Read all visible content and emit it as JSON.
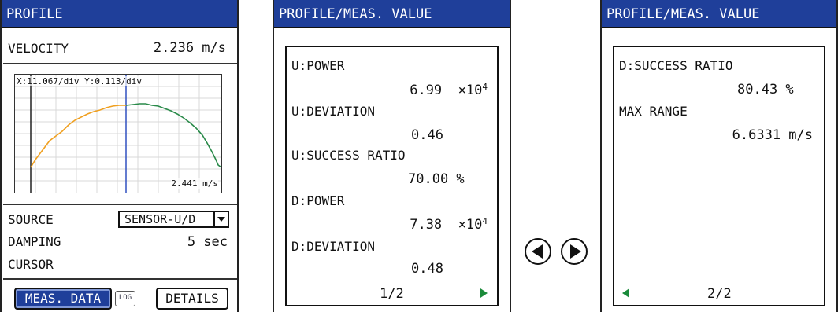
{
  "profile_panel": {
    "title": "PROFILE",
    "velocity_label": "VELOCITY",
    "velocity_value": "2.236 m/s",
    "graph_scale": "X:11.067/div Y:0.113/div",
    "graph_value": "2.441 m/s",
    "source_label": "SOURCE",
    "source_value": "SENSOR-U/D",
    "damping_label": "DAMPING",
    "damping_value": "5 sec",
    "cursor_label": "CURSOR",
    "meas_button": "MEAS. DATA",
    "log_badge": "LOG",
    "details_button": "DETAILS"
  },
  "page1": {
    "title": "PROFILE/MEAS. VALUE",
    "items": [
      {
        "label": "U:POWER",
        "value": "6.99",
        "unit": "×10",
        "exp": "4"
      },
      {
        "label": "U:DEVIATION",
        "value": "0.46",
        "unit": "",
        "exp": ""
      },
      {
        "label": "U:SUCCESS RATIO",
        "value": "70.00 %",
        "unit": "",
        "exp": ""
      },
      {
        "label": "D:POWER",
        "value": "7.38",
        "unit": "×10",
        "exp": "4"
      },
      {
        "label": "D:DEVIATION",
        "value": "0.48",
        "unit": "",
        "exp": ""
      }
    ],
    "page_indicator": "1/2"
  },
  "page2": {
    "title": "PROFILE/MEAS. VALUE",
    "items": [
      {
        "label": "D:SUCCESS RATIO",
        "value": "80.43 %"
      },
      {
        "label": "MAX RANGE",
        "value": "6.6331 m/s"
      }
    ],
    "page_indicator": "2/2"
  },
  "colors": {
    "title_bar": "#1f3f9a",
    "curve_u": "#f0a020",
    "curve_d": "#2a8a4a",
    "cursor_line": "#3050c0",
    "arrow_green": "#1a8a3a"
  },
  "icons": [
    "prev-page-icon",
    "next-page-icon",
    "dropdown-arrow-icon"
  ]
}
